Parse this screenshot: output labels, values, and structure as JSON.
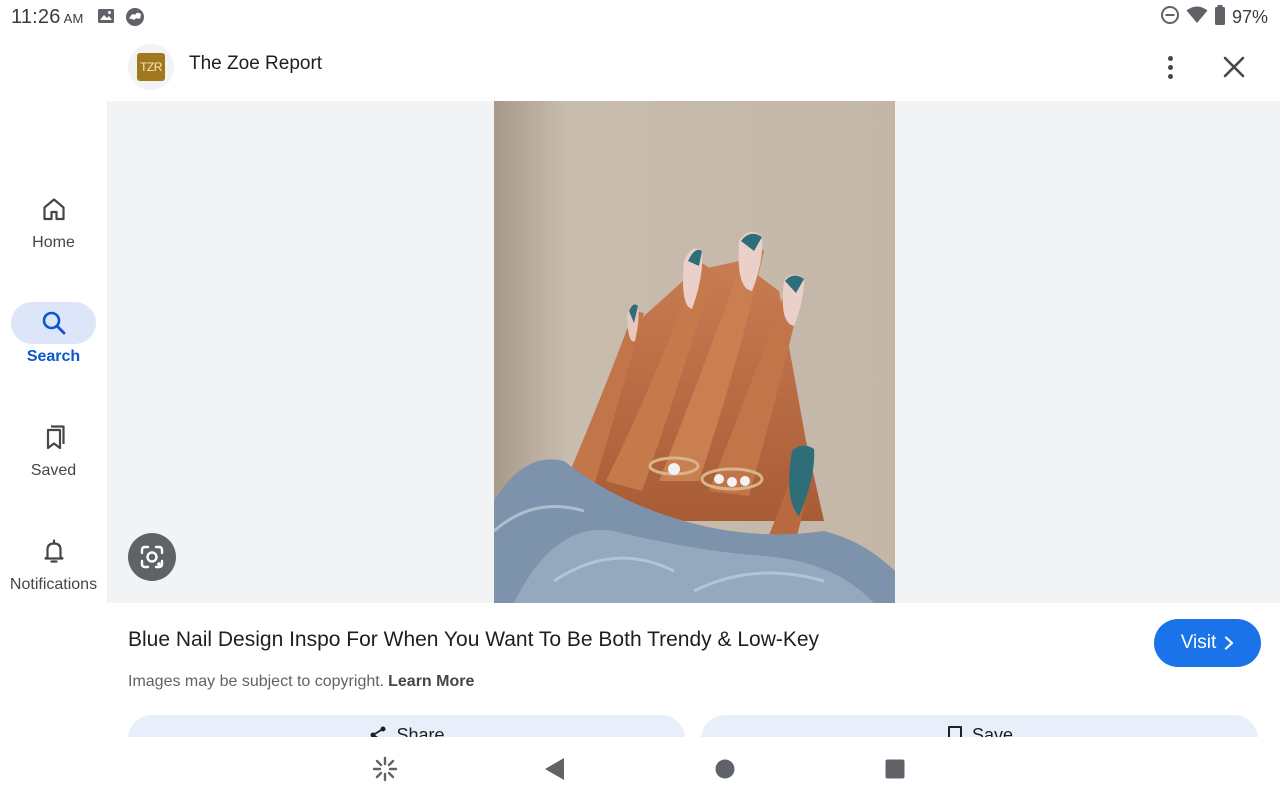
{
  "status_bar": {
    "time": "11:26",
    "ampm": "AM",
    "battery": "97%",
    "left_icons": [
      "image-icon",
      "app-notification-icon"
    ],
    "right_icons": [
      "do-not-disturb-icon",
      "wifi-icon",
      "battery-icon"
    ]
  },
  "header": {
    "site_logo_text": "TZR",
    "site_name": "The Zoe Report",
    "more_icon": "more-vert-icon",
    "close_icon": "close-icon"
  },
  "side_nav": {
    "items": [
      {
        "label": "Home",
        "icon": "home-icon",
        "active": false
      },
      {
        "label": "Search",
        "icon": "search-icon",
        "active": true
      },
      {
        "label": "Saved",
        "icon": "bookmarks-icon",
        "active": false
      },
      {
        "label": "Notifications",
        "icon": "bell-icon",
        "active": false
      }
    ]
  },
  "result": {
    "title": "Blue Nail Design Inspo For When You Want To Be Both Trendy & Low-Key",
    "visit_label": "Visit",
    "copyright_text": "Images may be subject to copyright.",
    "learn_more": "Learn More"
  },
  "actions": {
    "share_label": "Share",
    "save_label": "Save"
  },
  "colors": {
    "accent": "#1a73e8",
    "active_nav": "#0b57d0",
    "image_bg": "#f1f3f4",
    "action_bg": "#e8effb"
  }
}
